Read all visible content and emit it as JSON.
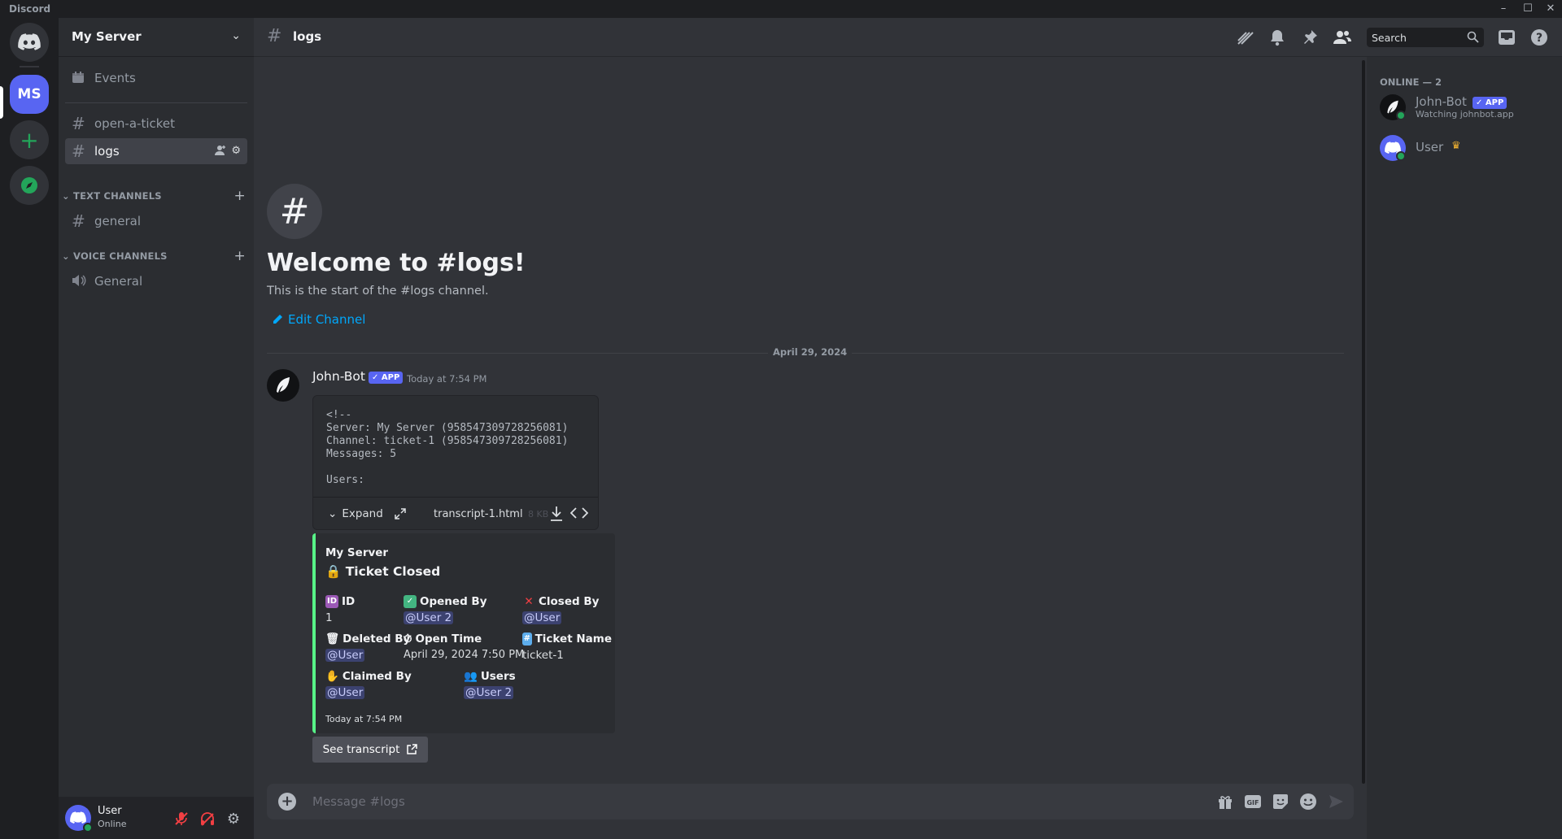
{
  "window": {
    "app_name": "Discord"
  },
  "guilds": {
    "server_initials": "MS"
  },
  "server": {
    "name": "My Server"
  },
  "channels": {
    "events_label": "Events",
    "top": [
      {
        "name": "open-a-ticket"
      },
      {
        "name": "logs"
      }
    ],
    "text_category": "TEXT CHANNELS",
    "text": [
      {
        "name": "general"
      }
    ],
    "voice_category": "VOICE CHANNELS",
    "voice": [
      {
        "name": "General"
      }
    ]
  },
  "user_panel": {
    "name": "User",
    "status": "Online"
  },
  "topbar": {
    "channel": "logs",
    "search_placeholder": "Search"
  },
  "welcome": {
    "title": "Welcome to #logs!",
    "subtitle": "This is the start of the #logs channel.",
    "edit_label": "Edit Channel"
  },
  "divider_date": "April 29, 2024",
  "message": {
    "author": "John-Bot",
    "app_tag": "APP",
    "time": "Today at 7:54 PM",
    "attachment": {
      "preview": "<!--\nServer: My Server (958547309728256081)\nChannel: ticket-1 (958547309728256081)\nMessages: 5\n\nUsers:",
      "expand_label": "Expand",
      "filename": "transcript-1.html",
      "size": "8 KB"
    },
    "embed": {
      "author": "My Server",
      "title": "Ticket Closed",
      "fields": [
        {
          "name": "ID",
          "value": "1"
        },
        {
          "name": "Opened By",
          "value": "@User 2"
        },
        {
          "name": "Closed By",
          "value": "@User"
        },
        {
          "name": "Deleted By",
          "value": "@User"
        },
        {
          "name": "Open Time",
          "value": "April 29, 2024 7:50 PM"
        },
        {
          "name": "Ticket Name",
          "value": "ticket-1"
        },
        {
          "name": "Claimed By",
          "value": "@User"
        },
        {
          "name": "Users",
          "value": "@User 2"
        }
      ],
      "footer": "Today at 7:54 PM",
      "accent_color": "#57f287"
    },
    "button_label": "See transcript"
  },
  "composer": {
    "placeholder": "Message #logs"
  },
  "members": {
    "heading": "ONLINE — 2",
    "list": [
      {
        "name": "John-Bot",
        "tag": "APP",
        "activity": "Watching johnbot.app"
      },
      {
        "name": "User"
      }
    ]
  },
  "colors": {
    "blurple": "#5865f2",
    "online": "#23a55a",
    "link": "#00a8fc"
  }
}
